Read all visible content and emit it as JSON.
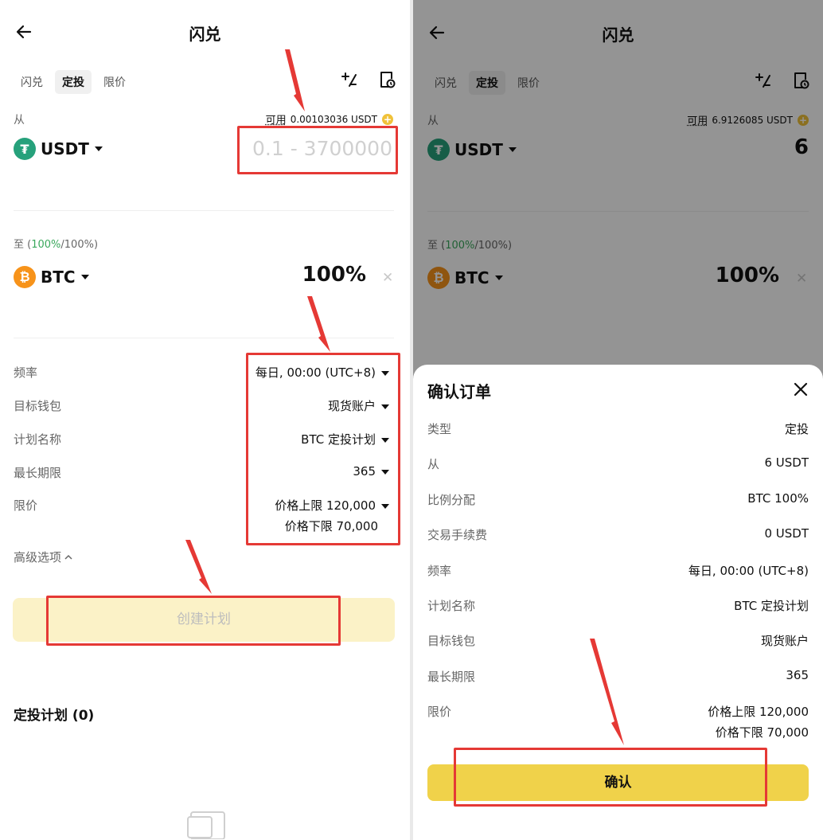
{
  "colors": {
    "accent": "#f0d24a",
    "accent_disabled": "#fbf2c7",
    "annotation": "#e53935",
    "usdt": "#26a17b",
    "btc": "#f7931a",
    "green": "#3aa85c"
  },
  "left": {
    "header_title": "闪兑",
    "tabs": [
      "闪兑",
      "定投",
      "限价"
    ],
    "from_label": "从",
    "available_label": "可用",
    "available_value": "0.00103036 USDT",
    "from_coin": "USDT",
    "amount_placeholder": "0.1 - 3700000",
    "to_label": "至",
    "to_pct_green": "100%",
    "to_pct_total": "/100%",
    "to_coin": "BTC",
    "to_pct": "100%",
    "rows": [
      {
        "label": "频率",
        "value": "每日, 00:00 (UTC+8)"
      },
      {
        "label": "目标钱包",
        "value": "现货账户"
      },
      {
        "label": "计划名称",
        "value": "BTC 定投计划"
      },
      {
        "label": "最长期限",
        "value": "365"
      },
      {
        "label": "限价",
        "value": "价格上限 120,000",
        "value2": "价格下限 70,000"
      }
    ],
    "advanced": "高级选项",
    "create_button": "创建计划",
    "plans_title": "定投计划 (0)"
  },
  "right": {
    "header_title": "闪兑",
    "tabs": [
      "闪兑",
      "定投",
      "限价"
    ],
    "from_label": "从",
    "available_label": "可用",
    "available_value": "6.9126085 USDT",
    "from_coin": "USDT",
    "amount": "6",
    "to_label": "至",
    "to_pct_green": "100%",
    "to_pct_total": "/100%",
    "to_coin": "BTC",
    "to_pct": "100%",
    "sheet": {
      "title": "确认订单",
      "rows": [
        {
          "label": "类型",
          "value": "定投"
        },
        {
          "label": "从",
          "value": "6 USDT"
        },
        {
          "label": "比例分配",
          "value": "BTC 100%"
        },
        {
          "label": "交易手续费",
          "value": "0 USDT"
        },
        {
          "label": "频率",
          "value": "每日, 00:00 (UTC+8)"
        },
        {
          "label": "计划名称",
          "value": "BTC 定投计划"
        },
        {
          "label": "目标钱包",
          "value": "现货账户"
        },
        {
          "label": "最长期限",
          "value": "365"
        },
        {
          "label": "限价",
          "value": "价格上限 120,000",
          "value2": "价格下限 70,000"
        }
      ],
      "confirm_button": "确认"
    }
  }
}
